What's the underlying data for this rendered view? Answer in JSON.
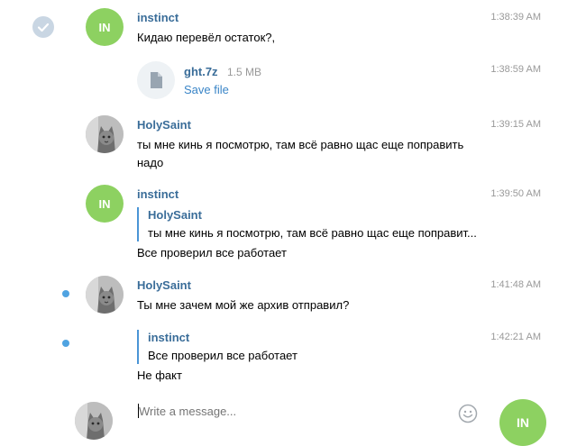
{
  "messages": [
    {
      "author": "instinct",
      "time": "1:38:39 AM",
      "text": "Кидаю перевёл остаток?,",
      "avatar_initials": "IN"
    },
    {
      "time": "1:38:59 AM",
      "file": {
        "name": "ght.7z",
        "size": "1.5 MB",
        "action": "Save file"
      }
    },
    {
      "author": "HolySaint",
      "time": "1:39:15 AM",
      "lines": [
        "ты мне кинь я посмотрю, там всё равно щас еще поправить",
        "надо"
      ]
    },
    {
      "author": "instinct",
      "time": "1:39:50 AM",
      "avatar_initials": "IN",
      "reply": {
        "author": "HolySaint",
        "text": "ты мне кинь я посмотрю, там всё равно щас еще поправит..."
      },
      "text": "Все проверил все работает"
    },
    {
      "author": "HolySaint",
      "time": "1:41:48 AM",
      "text": "Ты мне зачем мой же архив отправил?"
    },
    {
      "time": "1:42:21 AM",
      "reply": {
        "author": "instinct",
        "text": "Все проверил все работает"
      },
      "text": "Не факт"
    }
  ],
  "composer": {
    "placeholder": "Write a message...",
    "send_avatar_initials": "IN"
  },
  "colors": {
    "accent": "#4a95d6",
    "author": "#3a6d99",
    "avatar_in": "#8dd161",
    "unread": "#4fa3e1"
  }
}
